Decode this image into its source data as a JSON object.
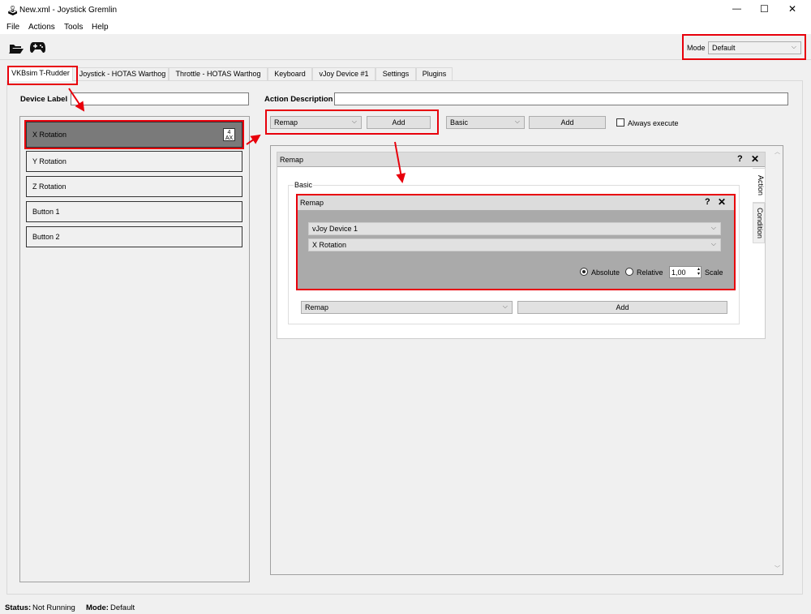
{
  "window": {
    "title": "New.xml - Joystick Gremlin",
    "minimize": "—",
    "maximize": "☐",
    "close": "✕"
  },
  "menu": [
    "File",
    "Actions",
    "Tools",
    "Help"
  ],
  "toolbar": {
    "open_icon": "folder-open-icon",
    "device_icon": "gamepad-icon",
    "mode_label": "Mode",
    "mode_value": "Default"
  },
  "tabs": [
    "VKBsim T-Rudder",
    "Joystick - HOTAS Warthog",
    "Throttle - HOTAS Warthog",
    "Keyboard",
    "vJoy Device #1",
    "Settings",
    "Plugins"
  ],
  "device_label": "Device Label",
  "device_label_value": "",
  "inputs": [
    {
      "label": "X Rotation",
      "badge_top": "4",
      "badge_bottom": "AX"
    },
    {
      "label": "Y Rotation"
    },
    {
      "label": "Z Rotation"
    },
    {
      "label": "Button 1"
    },
    {
      "label": "Button 2"
    }
  ],
  "action_description": "Action Description",
  "action_description_value": "",
  "action_select": "Remap",
  "add_label": "Add",
  "container_select": "Basic",
  "container_add": "Add",
  "always_execute": "Always execute",
  "container": {
    "title": "Remap",
    "help": "?",
    "close": "✕",
    "side_tabs": [
      "Action",
      "Condition"
    ],
    "group_label": "Basic",
    "remap": {
      "title": "Remap",
      "help": "?",
      "close": "✕",
      "device": "vJoy Device 1",
      "axis": "X Rotation",
      "absolute": "Absolute",
      "relative": "Relative",
      "scale_value": "1,00",
      "scale_label": "Scale"
    },
    "inner_select": "Remap",
    "inner_add": "Add"
  },
  "status": {
    "status_label": "Status:",
    "status_value": "Not Running",
    "mode_label": "Mode:",
    "mode_value": "Default"
  },
  "colors": {
    "highlight": "#e8000b",
    "selected_item": "#7a7a7a",
    "remap_body": "#aaaaaa"
  }
}
